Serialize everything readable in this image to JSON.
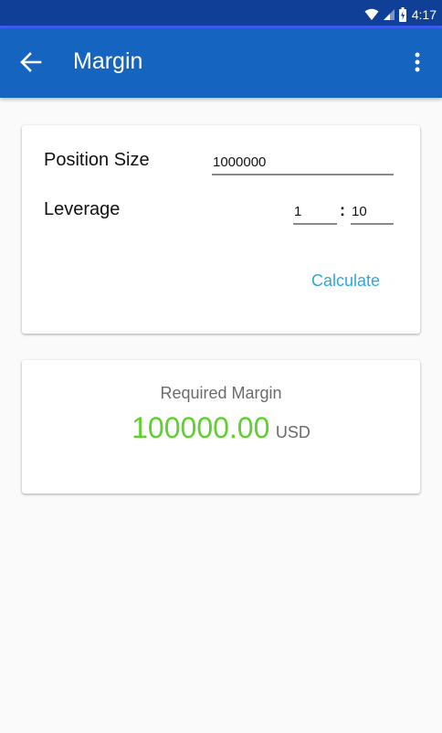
{
  "status_bar": {
    "time": "4:17",
    "icons": [
      "wifi-icon",
      "cell-signal-icon",
      "battery-charging-icon"
    ]
  },
  "app_bar": {
    "title": "Margin",
    "back_icon": "arrow-back-icon",
    "menu_icon": "more-vert-icon"
  },
  "form": {
    "position_size_label": "Position Size",
    "position_size_value": "1000000",
    "leverage_label": "Leverage",
    "leverage_left_value": "1",
    "leverage_separator": ":",
    "leverage_right_value": "10",
    "calculate_label": "Calculate"
  },
  "result": {
    "label": "Required Margin",
    "value": "100000.00",
    "unit": "USD"
  },
  "colors": {
    "status_bar": "#0f3f96",
    "app_bar": "#1565c0",
    "accent_button": "#29a9e0",
    "result_value": "#5fd02e"
  }
}
